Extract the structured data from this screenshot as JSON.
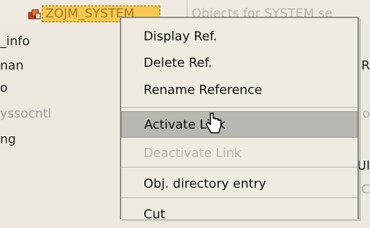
{
  "tree": {
    "selected_node_label": "ZOJM_SYSTEM",
    "background_text": "Objects for SYSTEM se",
    "rows": [
      {
        "left": "_info",
        "right": ""
      },
      {
        "left": "nan",
        "right": "R"
      },
      {
        "left": "o",
        "right": ""
      },
      {
        "left": "yssocntl",
        "right": "o"
      },
      {
        "left": "ng",
        "right": ""
      },
      {
        "left": "",
        "right": "UI"
      },
      {
        "left": "",
        "right": "C"
      }
    ]
  },
  "context_menu": {
    "items": [
      {
        "label": "Display Ref.",
        "state": "enabled"
      },
      {
        "label": "Delete Ref.",
        "state": "enabled"
      },
      {
        "label": "Rename Reference",
        "state": "enabled"
      },
      {
        "label": "Activate Link",
        "state": "hover"
      },
      {
        "label": "Deactivate Link",
        "state": "disabled"
      },
      {
        "label": "Obj. directory entry",
        "state": "enabled"
      },
      {
        "label": "Cut",
        "state": "enabled"
      }
    ]
  },
  "colors": {
    "selection": "#f7c84f",
    "menu_background": "#efebe1",
    "hover": "#b9b7b2",
    "disabled_text": "#b7b3aa"
  }
}
